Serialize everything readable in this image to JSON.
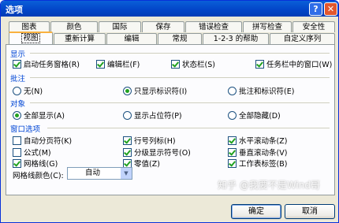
{
  "window": {
    "title": "选项",
    "help_glyph": "?",
    "close_glyph": "✕"
  },
  "tabs_row1": [
    "图表",
    "颜色",
    "国际",
    "保存",
    "错误检查",
    "拼写检查",
    "安全性"
  ],
  "tabs_row2": [
    "视图",
    "重新计算",
    "编辑",
    "常规",
    "1-2-3 的帮助",
    "自定义序列"
  ],
  "active_tab": "视图",
  "sections": {
    "display": "显示",
    "comments": "批注",
    "objects": "对象",
    "window_options": "窗口选项"
  },
  "display": {
    "startup_pane": {
      "label": "启动任务窗格(R)",
      "checked": true
    },
    "formula_bar": {
      "label": "编辑栏(F)",
      "checked": true
    },
    "status_bar": {
      "label": "状态栏(S)",
      "checked": true
    },
    "windows_in_taskbar": {
      "label": "任务栏中的窗口(W)",
      "checked": true
    }
  },
  "comments": {
    "none": {
      "label": "无(N)",
      "selected": false
    },
    "indicator_only": {
      "label": "只显示标识符(I)",
      "selected": true
    },
    "comment_and_indicator": {
      "label": "批注和标识符(E)",
      "selected": false
    }
  },
  "objects": {
    "show_all": {
      "label": "全部显示(A)",
      "selected": true
    },
    "show_placeholders": {
      "label": "显示占位符(P)",
      "selected": false
    },
    "hide_all": {
      "label": "全部隐藏(D)",
      "selected": false
    }
  },
  "window_options": {
    "page_breaks": {
      "label": "自动分页符(K)",
      "checked": false
    },
    "row_col_headers": {
      "label": "行号列标(H)",
      "checked": true
    },
    "horizontal_scroll": {
      "label": "水平滚动条(Z)",
      "checked": true
    },
    "formulas": {
      "label": "公式(M)",
      "checked": false
    },
    "outline_symbols": {
      "label": "分级显示符号(O)",
      "checked": true
    },
    "vertical_scroll": {
      "label": "垂直滚动条(V)",
      "checked": true
    },
    "gridlines": {
      "label": "网格线(G)",
      "checked": true
    },
    "zero_values": {
      "label": "零值(Z)",
      "checked": true
    },
    "sheet_tabs": {
      "label": "工作表标签(B)",
      "checked": true
    },
    "gridline_color_label": "网格线颜色(C):",
    "gridline_color_value": "自动"
  },
  "buttons": {
    "ok": "确定",
    "cancel": "取消"
  },
  "watermark": "知乎 @我要不是Wind哥",
  "colors": {
    "titlebar": "#0346c9",
    "section_text": "#0046d5",
    "check": "#21a121",
    "active_tab_top": "#f9b13f"
  }
}
